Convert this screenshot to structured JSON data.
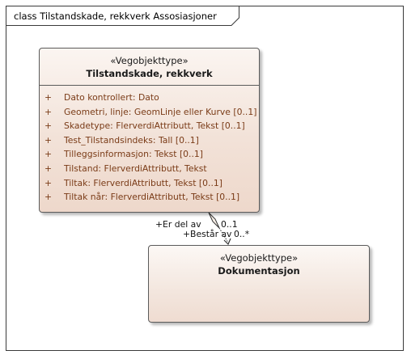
{
  "diagram": {
    "frame_title": "class Tilstandskade, rekkverk Assosiasjoner"
  },
  "classes": {
    "source": {
      "stereotype": "«Vegobjekttype»",
      "name": "Tilstandskade, rekkverk",
      "attributes": [
        {
          "visibility": "+",
          "text": "Dato kontrollert: Dato"
        },
        {
          "visibility": "+",
          "text": "Geometri, linje: GeomLinje eller Kurve [0..1]"
        },
        {
          "visibility": "+",
          "text": "Skadetype: FlerverdiAttributt, Tekst [0..1]"
        },
        {
          "visibility": "+",
          "text": "Test_Tilstandsindeks: Tall [0..1]"
        },
        {
          "visibility": "+",
          "text": "Tilleggsinformasjon: Tekst [0..1]"
        },
        {
          "visibility": "+",
          "text": "Tilstand: FlerverdiAttributt, Tekst"
        },
        {
          "visibility": "+",
          "text": "Tiltak: FlerverdiAttributt, Tekst [0..1]"
        },
        {
          "visibility": "+",
          "text": "Tiltak når: FlerverdiAttributt, Tekst [0..1]"
        }
      ]
    },
    "target": {
      "stereotype": "«Vegobjekttype»",
      "name": "Dokumentasjon",
      "attributes": []
    }
  },
  "association": {
    "source_role": "+Er del av",
    "source_multiplicity": "0..1",
    "target_role": "+Består av",
    "target_multiplicity": "0..*",
    "aggregation": "shared"
  },
  "colors": {
    "attribute_text": "#7a3b17",
    "class_fill": "#f2e2d8",
    "border": "#5b5b5b"
  }
}
